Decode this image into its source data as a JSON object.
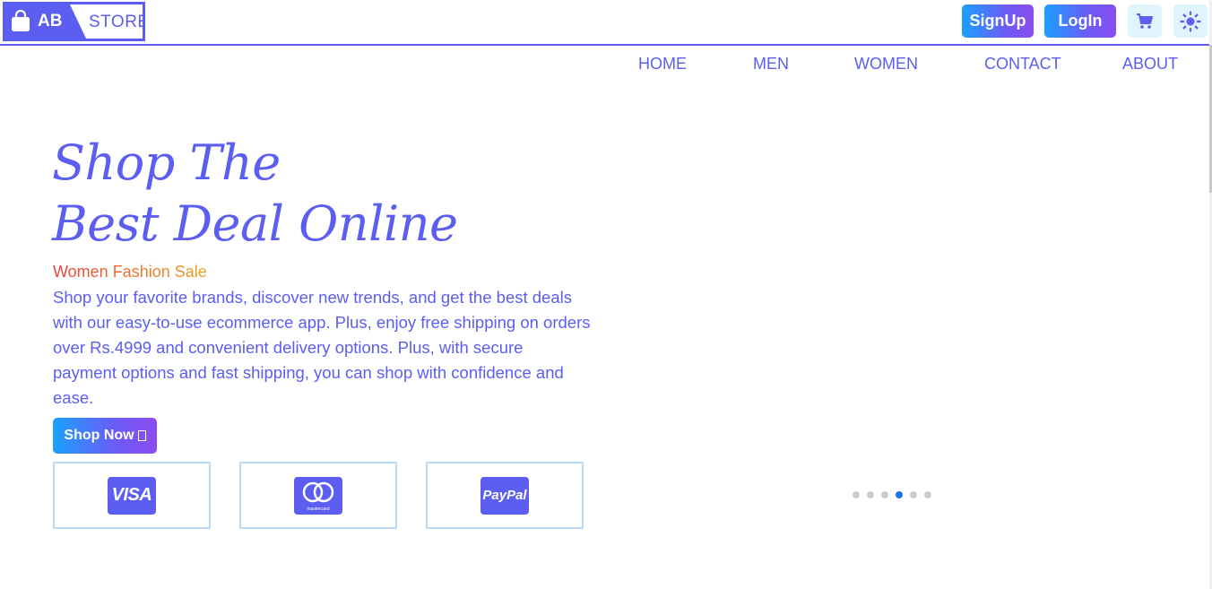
{
  "brand": {
    "left": "AB",
    "right": "STORE"
  },
  "header": {
    "signup_label": "SignUp",
    "login_label": "LogIn"
  },
  "nav": [
    {
      "label": "HOME"
    },
    {
      "label": "MEN"
    },
    {
      "label": "WOMEN"
    },
    {
      "label": "CONTACT"
    },
    {
      "label": "ABOUT"
    }
  ],
  "hero": {
    "title_line1": "Shop The",
    "title_line2": "Best Deal Online",
    "subtitle": "Women Fashion Sale",
    "description": "Shop your favorite brands, discover new trends, and get the best deals with our easy-to-use ecommerce app. Plus, enjoy free shipping on orders over Rs.4999 and convenient delivery options. Plus, with secure payment options and fast shipping, you can shop with confidence and ease.",
    "cta_label": "Shop Now"
  },
  "payments": [
    {
      "name": "VISA"
    },
    {
      "name": "mastercard"
    },
    {
      "name": "PayPal"
    }
  ],
  "carousel": {
    "total_slides": 6,
    "active_index": 3
  },
  "colors": {
    "primary": "#5b5ef0",
    "gradient_start": "#1aa0ff",
    "gradient_end": "#8b4cf0",
    "sale_start": "#e8403a",
    "sale_end": "#f0a020",
    "icon_bg": "#dff4fb",
    "dot_active": "#1a73e8"
  },
  "icons": {
    "logo": "shopping-bag-icon",
    "cart": "cart-icon",
    "theme": "sun-icon"
  }
}
